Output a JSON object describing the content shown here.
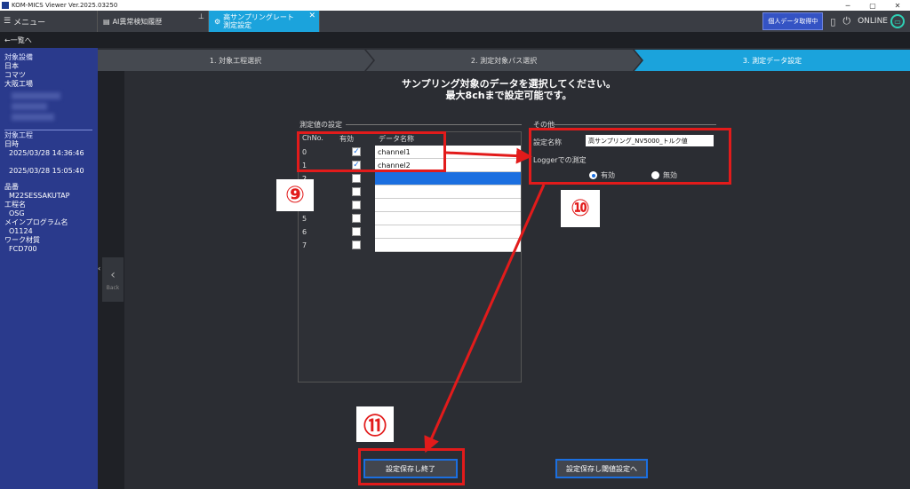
{
  "window": {
    "title": "KOM-MICS Viewer  Ver.2025.03250",
    "controls": [
      "─",
      "▢",
      "✕"
    ]
  },
  "tabbar": {
    "menu_label": "メニュー",
    "tabs": [
      {
        "label": "AI異常検知履歴"
      },
      {
        "label": "高サンプリングレート測定設定"
      }
    ],
    "personal_data_button": "個人データ取得中",
    "online_label": "ONLINE"
  },
  "backbar": {
    "label": "←一覧へ"
  },
  "sidebar": {
    "equipment_header": "対象設備",
    "equipment": [
      "日本",
      "コマツ",
      "大阪工場"
    ],
    "process_header": "対象工程",
    "datetime_header": "日時",
    "datetimes": [
      "2025/03/28 14:36:46",
      "2025/03/28 15:05:40"
    ],
    "part_header": "品番",
    "part": "M22SESSAKUTAP",
    "process_name_header": "工程名",
    "process_name": "OSG",
    "program_header": "メインプログラム名",
    "program": "O1124",
    "material_header": "ワーク材質",
    "material": "FCD700"
  },
  "steps": [
    "1. 対象工程選択",
    "2. 測定対象パス選択",
    "3. 測定データ設定"
  ],
  "back_tab_label": "Back",
  "main": {
    "heading_line1": "サンプリング対象のデータを選択してください。",
    "heading_line2": "最大8chまで設定可能です。",
    "measure_group": "測定値の設定",
    "columns": [
      "ChNo.",
      "有効",
      "データ名称"
    ],
    "rows": [
      {
        "ch": "0",
        "checked": "✓",
        "name": "channel1"
      },
      {
        "ch": "1",
        "checked": "✓",
        "name": "channel2"
      },
      {
        "ch": "2",
        "checked": "",
        "name": ""
      },
      {
        "ch": "3",
        "checked": "",
        "name": ""
      },
      {
        "ch": "4",
        "checked": "",
        "name": ""
      },
      {
        "ch": "5",
        "checked": "",
        "name": ""
      },
      {
        "ch": "6",
        "checked": "",
        "name": ""
      },
      {
        "ch": "7",
        "checked": "",
        "name": ""
      }
    ],
    "other_group": "その他",
    "setting_name_label": "設定名称",
    "setting_name_value": "高サンプリング_NV5000_トルク値",
    "logger_label": "Loggerでの測定",
    "radio_enabled": "有効",
    "radio_disabled": "無効",
    "save_end_button": "設定保存し終了",
    "save_threshold_button": "設定保存し閾値設定へ"
  },
  "annotations": {
    "callout_9": "⑨",
    "callout_10": "⑩",
    "callout_11": "⑪",
    "color": "#e21b1b"
  }
}
